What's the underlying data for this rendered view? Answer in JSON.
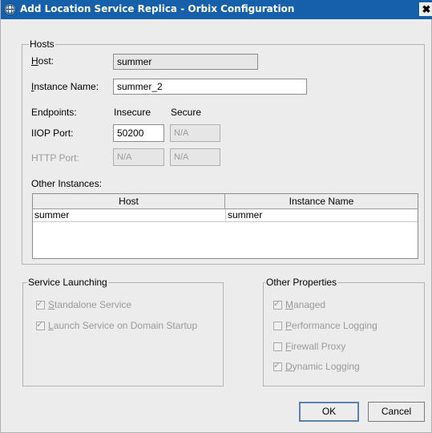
{
  "window": {
    "title": "Add Location Service Replica - Orbix Configuration",
    "close_glyph": "✖"
  },
  "hosts": {
    "legend": "Hosts",
    "host_label_prefix": "",
    "host_label_u": "H",
    "host_label_rest": "ost:",
    "host_value": "summer",
    "instance_label_u": "I",
    "instance_label_rest": "nstance Name:",
    "instance_value": "summer_2",
    "endpoints_label": "Endpoints:",
    "insecure_label": "Insecure",
    "secure_label": "Secure",
    "iiop_label": "IIOP Port:",
    "iiop_insecure": "50200",
    "iiop_secure": "N/A",
    "http_label": "HTTP Port:",
    "http_insecure": "N/A",
    "http_secure": "N/A",
    "other_instances_label": "Other Instances:",
    "table": {
      "columns": [
        "Host",
        "Instance Name"
      ],
      "rows": [
        {
          "host": "summer",
          "instance": "summer"
        }
      ]
    }
  },
  "service_launching": {
    "legend": "Service Launching",
    "standalone": {
      "u": "S",
      "rest": "tandalone Service",
      "checked": true
    },
    "launch": {
      "u": "L",
      "rest": "aunch Service on Domain Startup",
      "checked": true
    }
  },
  "other_properties": {
    "legend": "Other Properties",
    "managed": {
      "u": "M",
      "rest": "anaged",
      "checked": true
    },
    "performance": {
      "u": "P",
      "rest": "erformance Logging",
      "checked": false
    },
    "firewall": {
      "u": "F",
      "rest": "irewall Proxy",
      "checked": false
    },
    "dynamic": {
      "u": "D",
      "rest": "ynamic Logging",
      "checked": true
    }
  },
  "buttons": {
    "ok": "OK",
    "cancel": "Cancel"
  },
  "check_glyph": "✓"
}
